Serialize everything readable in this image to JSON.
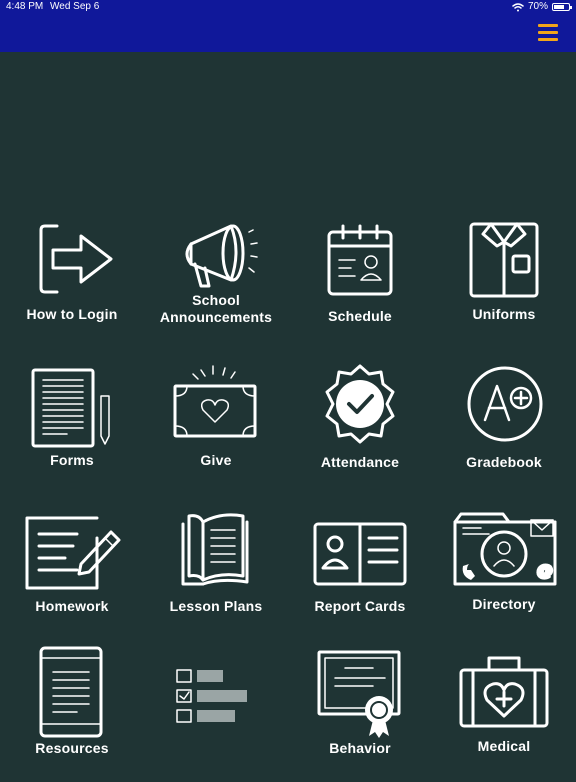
{
  "status_bar": {
    "time": "4:48 PM",
    "date": "Wed Sep 6",
    "battery": "70%",
    "battery_level": 0.7
  },
  "header": {
    "menu_icon": "hamburger-icon",
    "background_color": "#10189a",
    "menu_color": "#f2a51a"
  },
  "tiles": [
    {
      "label": "How to Login",
      "icon": "login-arrow-icon"
    },
    {
      "label": "School Announcements",
      "icon": "megaphone-icon"
    },
    {
      "label": "Schedule",
      "icon": "calendar-icon"
    },
    {
      "label": "Uniforms",
      "icon": "shirt-icon"
    },
    {
      "label": "Forms",
      "icon": "form-document-icon"
    },
    {
      "label": "Give",
      "icon": "money-heart-icon"
    },
    {
      "label": "Attendance",
      "icon": "badge-check-icon"
    },
    {
      "label": "Gradebook",
      "icon": "a-plus-grade-icon"
    },
    {
      "label": "Homework",
      "icon": "paper-pencil-icon"
    },
    {
      "label": "Lesson Plans",
      "icon": "open-book-icon"
    },
    {
      "label": "Report Cards",
      "icon": "report-card-icon"
    },
    {
      "label": "Directory",
      "icon": "contact-directory-icon"
    },
    {
      "label": "Resources",
      "icon": "tablet-icon"
    },
    {
      "label": "",
      "icon": "checklist-icon"
    },
    {
      "label": "Behavior",
      "icon": "certificate-icon"
    },
    {
      "label": "Medical",
      "icon": "medical-kit-icon"
    }
  ]
}
